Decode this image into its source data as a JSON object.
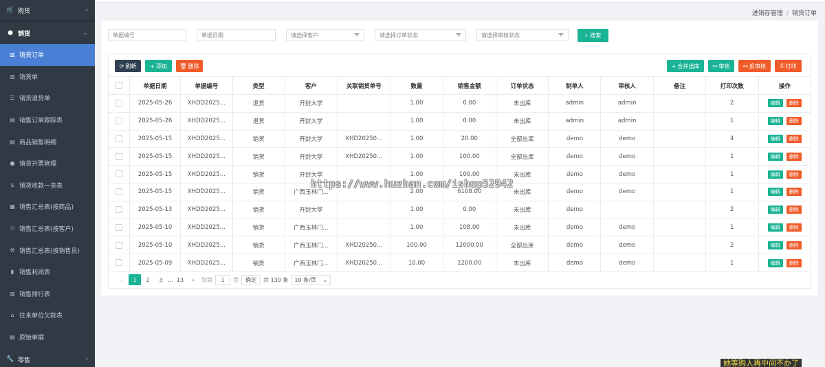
{
  "sidebar": {
    "group_purchase": {
      "label": "购货",
      "icon": "cart-icon"
    },
    "group_sales": {
      "label": "销货",
      "icon": "apple-icon"
    },
    "items": [
      {
        "label": "销货订单",
        "icon": "chart-icon",
        "active": true
      },
      {
        "label": "销货单",
        "icon": "chart-icon"
      },
      {
        "label": "销货退货单",
        "icon": "database-icon"
      },
      {
        "label": "销售订单跟踪表",
        "icon": "document-icon"
      },
      {
        "label": "商品销售明细",
        "icon": "document-icon"
      },
      {
        "label": "销货开票管理",
        "icon": "circle-icon"
      },
      {
        "label": "销货收款一览表",
        "icon": "dollar-icon"
      },
      {
        "label": "销售汇总表(按商品)",
        "icon": "calculator-icon"
      },
      {
        "label": "销售汇总表(按客户)",
        "icon": "users-icon"
      },
      {
        "label": "销售汇总表(按销售员)",
        "icon": "gavel-icon"
      },
      {
        "label": "销售利润表",
        "icon": "bookmark-icon"
      },
      {
        "label": "销售排行表",
        "icon": "chart-icon"
      },
      {
        "label": "往来单位欠款表",
        "icon": "bank-icon"
      },
      {
        "label": "原始单据",
        "icon": "book-icon"
      }
    ],
    "group_retail": {
      "label": "零售",
      "icon": "wrench-icon"
    }
  },
  "breadcrumb": {
    "parent": "进销存管理",
    "current": "销货订单"
  },
  "filters": {
    "doc_no_placeholder": "单据编号",
    "doc_date_placeholder": "单据日期",
    "customer_placeholder": "请选择客户",
    "order_status_placeholder": "请选择订单状态",
    "audit_status_placeholder": "请选择审核状态",
    "search_label": "搜索"
  },
  "toolbar": {
    "refresh": "刷新",
    "add": "添加",
    "delete": "删除",
    "merge_out": "合并出库",
    "audit": "审核",
    "unaudit": "反审核",
    "print": "打印"
  },
  "table": {
    "headers": [
      "单据日期",
      "单据编号",
      "类型",
      "客户",
      "关联销货单号",
      "数量",
      "销售金额",
      "订单状态",
      "制单人",
      "审核人",
      "备注",
      "打印次数",
      "操作"
    ],
    "edit_label": "编辑",
    "delete_label": "删除",
    "rows": [
      [
        "2025-05-26",
        "XHDD2025...",
        "退货",
        "开封大学",
        "",
        "1.00",
        "0.00",
        "未出库",
        "admin",
        "admin",
        "",
        "2"
      ],
      [
        "2025-05-26",
        "XHDD2025...",
        "退货",
        "开封大学",
        "",
        "1.00",
        "0.00",
        "未出库",
        "admin",
        "admin",
        "",
        "1"
      ],
      [
        "2025-05-15",
        "XHDD2025...",
        "销货",
        "开封大学",
        "XHD20250...",
        "1.00",
        "20.00",
        "全部出库",
        "demo",
        "demo",
        "",
        "4"
      ],
      [
        "2025-05-15",
        "XHDD2025...",
        "销货",
        "开封大学",
        "XHD20250...",
        "1.00",
        "100.00",
        "全部出库",
        "demo",
        "demo",
        "",
        "1"
      ],
      [
        "2025-05-15",
        "XHDD2025...",
        "销货",
        "开封大学",
        "",
        "1.00",
        "100.00",
        "未出库",
        "demo",
        "demo",
        "",
        "1"
      ],
      [
        "2025-05-15",
        "XHDD2025...",
        "销货",
        "广西玉林门...",
        "",
        "2.00",
        "6108.00",
        "未出库",
        "demo",
        "demo",
        "",
        "1"
      ],
      [
        "2025-05-13",
        "XHDD2025...",
        "销货",
        "开封大学",
        "",
        "1.00",
        "0.00",
        "未出库",
        "demo",
        "",
        "",
        "2"
      ],
      [
        "2025-05-10",
        "XHDD2025...",
        "销货",
        "广西玉林门...",
        "",
        "1.00",
        "108.00",
        "未出库",
        "demo",
        "demo",
        "",
        "1"
      ],
      [
        "2025-05-10",
        "XHDD2025...",
        "销货",
        "广西玉林门...",
        "XHD20250...",
        "100.00",
        "12000.00",
        "全部出库",
        "demo",
        "demo",
        "",
        "2"
      ],
      [
        "2025-05-09",
        "XHDD2025...",
        "销货",
        "广西玉林门...",
        "XHD20250...",
        "10.00",
        "1200.00",
        "未出库",
        "demo",
        "demo",
        "",
        "1"
      ]
    ]
  },
  "pagination": {
    "prev": "‹",
    "pages": [
      "1",
      "2",
      "3",
      "...",
      "13"
    ],
    "current": "1",
    "next": "›",
    "goto_label": "到第",
    "goto_value": "1",
    "page_unit": "页",
    "confirm": "确定",
    "total": "共 130 条",
    "page_size": "10 条/页"
  },
  "watermark": "https://www.huzhan.com/ishop52942",
  "corner_text": "她等购人再中间不办了",
  "colors": {
    "sidebar_bg": "#2f3a45",
    "active": "#4a7fd6",
    "teal": "#1ab394",
    "orange": "#f05b2a",
    "dark_button": "#2f4050"
  }
}
